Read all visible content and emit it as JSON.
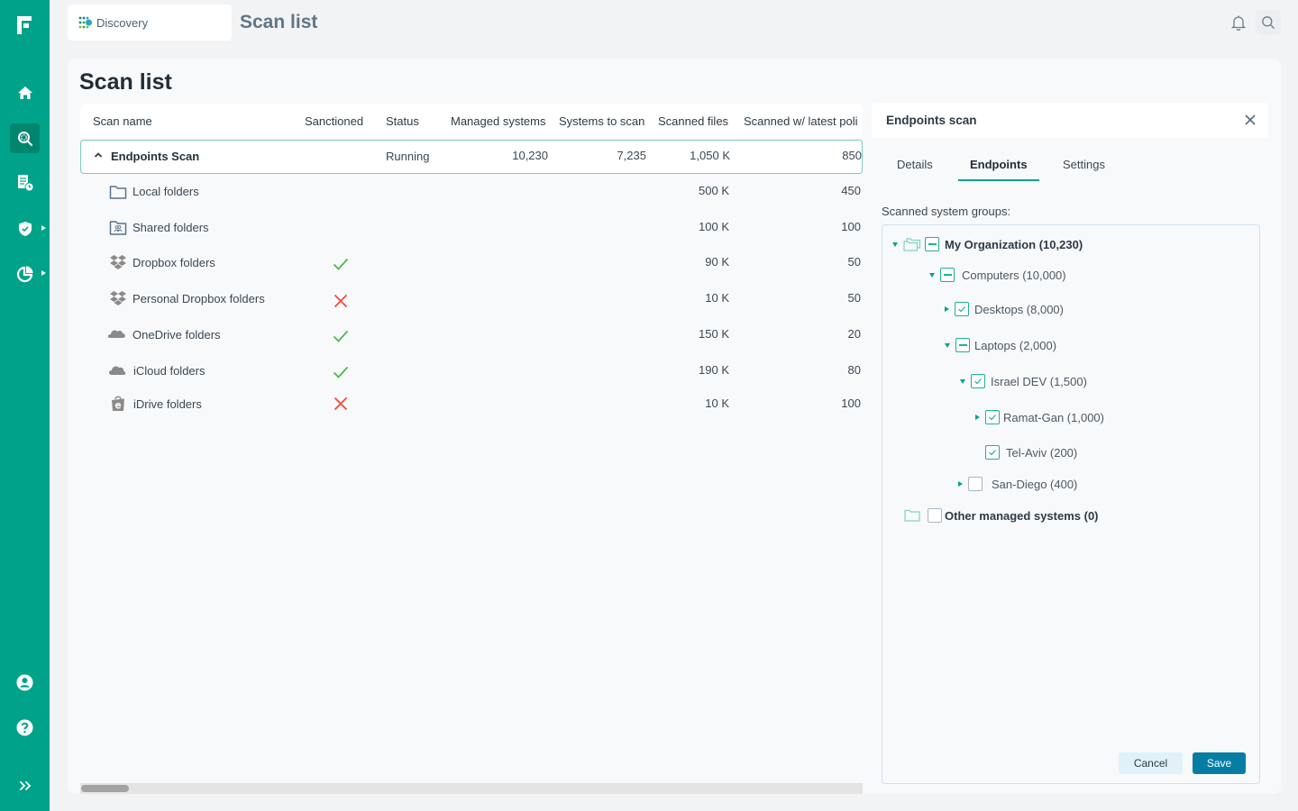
{
  "sidebar": {
    "logo": "f-logo",
    "items": [
      {
        "name": "home",
        "icon": "home-icon",
        "active": false
      },
      {
        "name": "discovery",
        "icon": "discovery-search-icon",
        "active": true
      },
      {
        "name": "reports",
        "icon": "report-clock-icon",
        "active": false
      },
      {
        "name": "protection",
        "icon": "shield-check-icon",
        "active": false,
        "has_submenu": true
      },
      {
        "name": "analytics",
        "icon": "pie-chart-icon",
        "active": false,
        "has_submenu": true
      }
    ],
    "bottom_items": [
      {
        "name": "account",
        "icon": "user-icon"
      },
      {
        "name": "help",
        "icon": "help-icon"
      },
      {
        "name": "expand",
        "icon": "double-chevron-right-icon"
      }
    ]
  },
  "header": {
    "app_name": "Discovery",
    "title": "Scan list",
    "notifications_icon": "bell-icon",
    "search_icon": "search-icon"
  },
  "page": {
    "title": "Scan list"
  },
  "table": {
    "columns": [
      "Scan name",
      "Sanctioned",
      "Status",
      "Managed systems",
      "Systems to scan",
      "Scanned files",
      "Scanned w/ latest poli"
    ],
    "parent_row": {
      "name": "Endpoints Scan",
      "expanded": true,
      "sanctioned": "",
      "status": "Running",
      "managed_systems": "10,230",
      "systems_to_scan": "7,235",
      "scanned_files": "1,050 K",
      "scanned_latest": "850"
    },
    "child_rows": [
      {
        "name": "Local folders",
        "icon": "folder-icon",
        "sanctioned": "",
        "scanned_files": "500 K",
        "scanned_latest": "450"
      },
      {
        "name": "Shared folders",
        "icon": "shared-folder-icon",
        "sanctioned": "",
        "scanned_files": "100 K",
        "scanned_latest": "100"
      },
      {
        "name": "Dropbox folders",
        "icon": "dropbox-icon",
        "sanctioned": "yes",
        "scanned_files": "90 K",
        "scanned_latest": "50"
      },
      {
        "name": "Personal Dropbox folders",
        "icon": "dropbox-icon",
        "sanctioned": "no",
        "scanned_files": "10 K",
        "scanned_latest": "50"
      },
      {
        "name": "OneDrive folders",
        "icon": "onedrive-icon",
        "sanctioned": "yes",
        "scanned_files": "150 K",
        "scanned_latest": "20"
      },
      {
        "name": "iCloud folders",
        "icon": "icloud-icon",
        "sanctioned": "yes",
        "scanned_files": "190 K",
        "scanned_latest": "80"
      },
      {
        "name": "iDrive folders",
        "icon": "idrive-icon",
        "sanctioned": "no",
        "scanned_files": "10 K",
        "scanned_latest": "100"
      }
    ]
  },
  "panel": {
    "title": "Endpoints scan",
    "tabs": [
      {
        "label": "Details",
        "active": false
      },
      {
        "label": "Endpoints",
        "active": true
      },
      {
        "label": "Settings",
        "active": false
      }
    ],
    "groups_label": "Scanned system groups:",
    "tree": [
      {
        "label": "My Organization (10,230)",
        "level": 0,
        "caret": "down",
        "state": "partial",
        "bold": true,
        "folder": "multi-folder"
      },
      {
        "label": "Computers (10,000)",
        "level": 1,
        "caret": "down",
        "state": "partial",
        "bold": false
      },
      {
        "label": "Desktops (8,000)",
        "level": 2,
        "caret": "right",
        "state": "checked",
        "bold": false
      },
      {
        "label": "Laptops (2,000)",
        "level": 2,
        "caret": "down",
        "state": "partial",
        "bold": false
      },
      {
        "label": "Israel DEV (1,500)",
        "level": 3,
        "caret": "down",
        "state": "checked",
        "bold": false
      },
      {
        "label": "Ramat-Gan (1,000)",
        "level": 4,
        "caret": "right",
        "state": "checked",
        "bold": false
      },
      {
        "label": "Tel-Aviv (200)",
        "level": 4,
        "caret": "none",
        "state": "checked",
        "bold": false
      },
      {
        "label": "San-Diego (400)",
        "level": 3,
        "caret": "right",
        "state": "unchecked",
        "bold": false
      },
      {
        "label": "Other managed systems (0)",
        "level": 0,
        "caret": "none",
        "state": "unchecked",
        "bold": true,
        "folder": "folder"
      }
    ],
    "cancel_label": "Cancel",
    "save_label": "Save"
  },
  "colors": {
    "brand": "#00a389",
    "brand_dark": "#00866f",
    "check_green": "#4cb84a",
    "cross_red": "#f04a3a",
    "save_blue": "#067ea4",
    "cancel_bg": "#e0f2f7",
    "row_highlight_border": "#7ccdbd"
  }
}
